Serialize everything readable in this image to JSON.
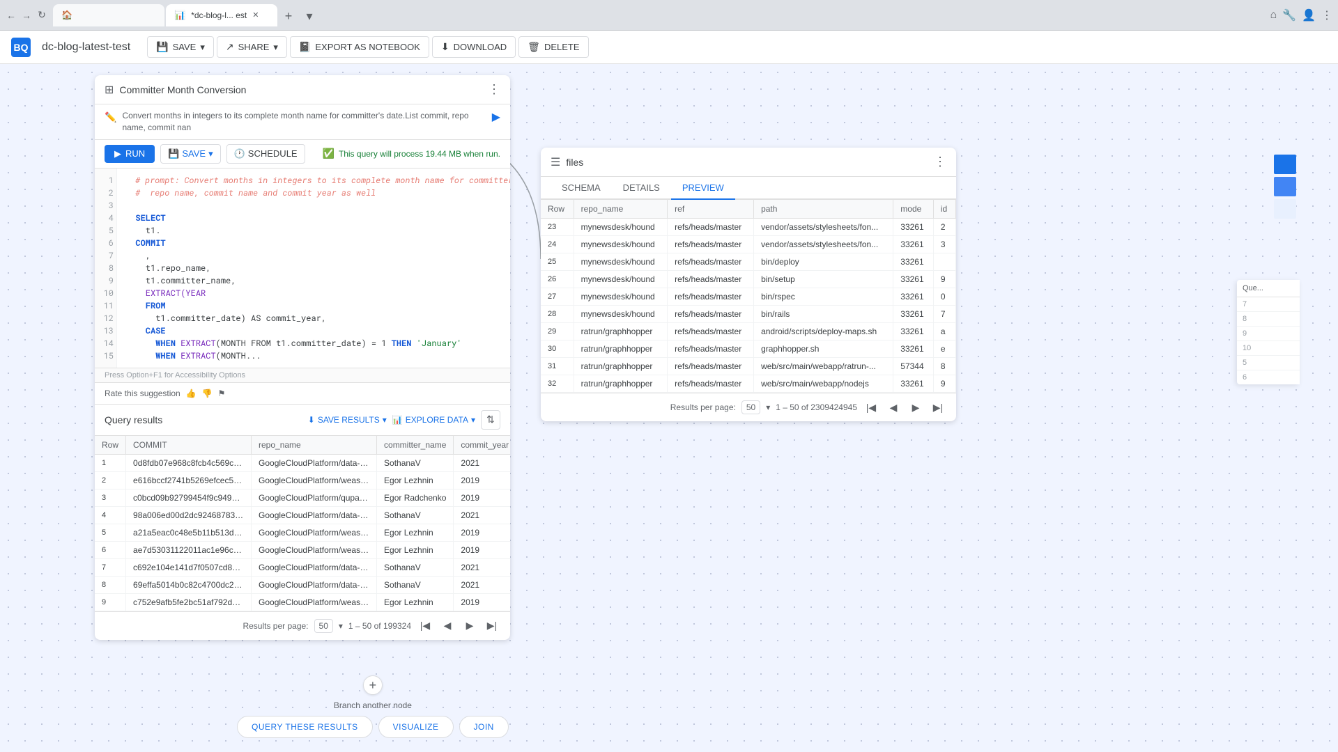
{
  "browser": {
    "tabs": [
      {
        "id": "home",
        "icon": "🏠",
        "label": "",
        "active": false,
        "closeable": false
      },
      {
        "id": "query",
        "icon": "📊",
        "label": "*dc-blog-l... est",
        "active": true,
        "closeable": true
      }
    ],
    "new_tab_label": "+",
    "right_icons": [
      "⊞",
      "☆",
      "⊕",
      "⋮"
    ]
  },
  "app_header": {
    "logo_icon": "BQ",
    "title": "dc-blog-latest-test",
    "buttons": [
      {
        "label": "SAVE",
        "icon": "💾",
        "has_dropdown": true
      },
      {
        "label": "SHARE",
        "icon": "↗",
        "has_dropdown": true
      },
      {
        "label": "EXPORT AS NOTEBOOK",
        "icon": "📓"
      },
      {
        "label": "DOWNLOAD",
        "icon": "⬇"
      },
      {
        "label": "DELETE",
        "icon": "🗑"
      }
    ]
  },
  "query_panel": {
    "title": "Committer Month Conversion",
    "prompt": "Convert months in integers to its complete month name for committer's date.List commit, repo name, commit nan",
    "toolbar": {
      "run_label": "RUN",
      "save_label": "SAVE",
      "schedule_label": "SCHEDULE",
      "process_info": "This query will process 19.44 MB when run."
    },
    "code_lines": [
      {
        "num": 1,
        "text": "# prompt: Convert months in integers to its complete month name for committers",
        "type": "comment"
      },
      {
        "num": 2,
        "text": "# repo name, commit name and commit year as well",
        "type": "comment"
      },
      {
        "num": 3,
        "text": "",
        "type": "normal"
      },
      {
        "num": 4,
        "text": "SELECT",
        "type": "keyword"
      },
      {
        "num": 5,
        "text": "  t1.",
        "type": "normal"
      },
      {
        "num": 6,
        "text": "COMMIT",
        "type": "keyword"
      },
      {
        "num": 7,
        "text": "  ,",
        "type": "normal"
      },
      {
        "num": 8,
        "text": "  t1.repo_name,",
        "type": "normal"
      },
      {
        "num": 9,
        "text": "  t1.committer_name,",
        "type": "normal"
      },
      {
        "num": 10,
        "text": "  EXTRACT(YEAR",
        "type": "function"
      },
      {
        "num": 11,
        "text": "  FROM",
        "type": "keyword"
      },
      {
        "num": 12,
        "text": "    t1.committer_date) AS commit_year,",
        "type": "normal"
      },
      {
        "num": 13,
        "text": "  CASE",
        "type": "keyword"
      },
      {
        "num": 14,
        "text": "    WHEN EXTRACT(MONTH FROM t1.committer_date) = 1 THEN 'January'",
        "type": "mixed"
      },
      {
        "num": 15,
        "text": "    WHEN EXTRACT(MONTH...",
        "type": "mixed"
      }
    ],
    "editor_footer": "Press Option+F1 for Accessibility Options",
    "rate_label": "Rate this suggestion",
    "results": {
      "title": "Query results",
      "save_results_label": "SAVE RESULTS",
      "explore_data_label": "EXPLORE DATA",
      "columns": [
        "Row",
        "COMMIT",
        "repo_name",
        "committer_name",
        "commit_year"
      ],
      "rows": [
        {
          "row": "1",
          "commit": "0d8fdb07e968c8fcb4c569cbb...",
          "repo_name": "GoogleCloudPlatform/data-sci-...",
          "committer_name": "SothanaV",
          "commit_year": "2021"
        },
        {
          "row": "2",
          "commit": "e616bccf2741b5269efcec5ac9...",
          "repo_name": "GoogleCloudPlatform/weasis-c...",
          "committer_name": "Egor Lezhnin",
          "commit_year": "2019"
        },
        {
          "row": "3",
          "commit": "c0bcd09b92799454f9c949a92...",
          "repo_name": "GoogleCloudPlatform/qupath-...",
          "committer_name": "Egor Radchenko",
          "commit_year": "2019"
        },
        {
          "row": "4",
          "commit": "98a006ed00d2dc9246878398...",
          "repo_name": "GoogleCloudPlatform/data-sci-...",
          "committer_name": "SothanaV",
          "commit_year": "2021"
        },
        {
          "row": "5",
          "commit": "a21a5eac0c48e5b11b513d46e...",
          "repo_name": "GoogleCloudPlatform/weasis-c...",
          "committer_name": "Egor Lezhnin",
          "commit_year": "2019"
        },
        {
          "row": "6",
          "commit": "ae7d53031122011ac1e96cd87...",
          "repo_name": "GoogleCloudPlatform/weasis-c...",
          "committer_name": "Egor Lezhnin",
          "commit_year": "2019"
        },
        {
          "row": "7",
          "commit": "c692e104e141d7f0507cd8ead...",
          "repo_name": "GoogleCloudPlatform/data-sci-...",
          "committer_name": "SothanaV",
          "commit_year": "2021"
        },
        {
          "row": "8",
          "commit": "69effa5014b0c82c4700dc283...",
          "repo_name": "GoogleCloudPlatform/data-sci-...",
          "committer_name": "SothanaV",
          "commit_year": "2021"
        },
        {
          "row": "9",
          "commit": "c752e9afb5fe2bc51af792d23f...",
          "repo_name": "GoogleCloudPlatform/weasis-c...",
          "committer_name": "Egor Lezhnin",
          "commit_year": "2019"
        }
      ],
      "pagination": {
        "per_page_label": "Results per page:",
        "per_page_value": "50",
        "range_text": "1 – 50 of 199324"
      }
    }
  },
  "files_panel": {
    "title": "files",
    "tabs": [
      "SCHEMA",
      "DETAILS",
      "PREVIEW"
    ],
    "active_tab": "PREVIEW",
    "columns": [
      "Row",
      "repo_name",
      "ref",
      "path",
      "mode",
      "id"
    ],
    "rows": [
      {
        "row": "23",
        "repo_name": "mynewsdesk/hound",
        "ref": "refs/heads/master",
        "path": "vendor/assets/stylesheets/fon...",
        "mode": "33261",
        "id": "2"
      },
      {
        "row": "24",
        "repo_name": "mynewsdesk/hound",
        "ref": "refs/heads/master",
        "path": "vendor/assets/stylesheets/fon...",
        "mode": "33261",
        "id": "3"
      },
      {
        "row": "25",
        "repo_name": "mynewsdesk/hound",
        "ref": "refs/heads/master",
        "path": "bin/deploy",
        "mode": "33261",
        "id": ""
      },
      {
        "row": "26",
        "repo_name": "mynewsdesk/hound",
        "ref": "refs/heads/master",
        "path": "bin/setup",
        "mode": "33261",
        "id": "9"
      },
      {
        "row": "27",
        "repo_name": "mynewsdesk/hound",
        "ref": "refs/heads/master",
        "path": "bin/rspec",
        "mode": "33261",
        "id": "0"
      },
      {
        "row": "28",
        "repo_name": "mynewsdesk/hound",
        "ref": "refs/heads/master",
        "path": "bin/rails",
        "mode": "33261",
        "id": "7"
      },
      {
        "row": "29",
        "repo_name": "ratrun/graphhopper",
        "ref": "refs/heads/master",
        "path": "android/scripts/deploy-maps.sh",
        "mode": "33261",
        "id": "a"
      },
      {
        "row": "30",
        "repo_name": "ratrun/graphhopper",
        "ref": "refs/heads/master",
        "path": "graphhopper.sh",
        "mode": "33261",
        "id": "e"
      },
      {
        "row": "31",
        "repo_name": "ratrun/graphhopper",
        "ref": "refs/heads/master",
        "path": "web/src/main/webapp/ratrun-...",
        "mode": "57344",
        "id": "8"
      },
      {
        "row": "32",
        "repo_name": "ratrun/graphhopper",
        "ref": "refs/heads/master",
        "path": "web/src/main/webapp/nodejs",
        "mode": "33261",
        "id": "9"
      }
    ],
    "pagination": {
      "per_page_label": "Results per page:",
      "per_page_value": "50",
      "range_text": "1 – 50 of 2309424945"
    }
  },
  "bottom_actions": {
    "branch_label": "Branch another node",
    "add_node_icon": "+",
    "buttons": [
      {
        "label": "QUERY THESE RESULTS"
      },
      {
        "label": "VISUALIZE"
      },
      {
        "label": "JOIN"
      }
    ]
  },
  "partial_panel": {
    "header": "Que...",
    "rows": [
      {
        "num": "7",
        "val": ""
      },
      {
        "num": "8",
        "val": ""
      },
      {
        "num": "9",
        "val": ""
      },
      {
        "num": "10",
        "val": ""
      },
      {
        "num": "5",
        "val": ""
      },
      {
        "num": "6",
        "val": ""
      }
    ]
  },
  "side_strip": {
    "buttons": [
      "■",
      "■",
      "■"
    ]
  }
}
